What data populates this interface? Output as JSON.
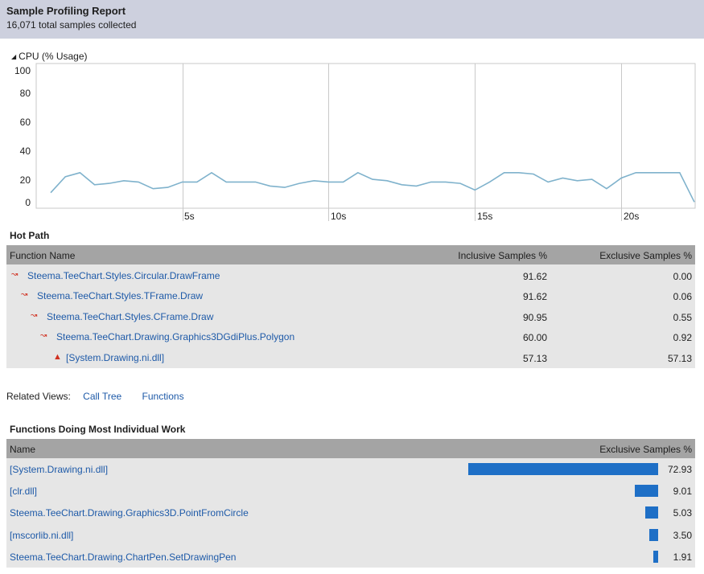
{
  "report": {
    "title": "Sample Profiling Report",
    "subtitle": "16,071 total samples collected"
  },
  "cpu": {
    "title": "CPU (% Usage)",
    "collapse_icon": "triangle-down-icon"
  },
  "chart_data": {
    "type": "line",
    "title": "CPU (% Usage)",
    "xlabel": "",
    "ylabel": "",
    "ylim": [
      0,
      100
    ],
    "xlim": [
      0,
      22
    ],
    "yticks": [
      "100",
      "80",
      "60",
      "40",
      "20",
      "0"
    ],
    "xticks": [
      "5s",
      "10s",
      "15s",
      "20s"
    ],
    "grid": true,
    "line_color": "#7fb2cc",
    "series": [
      {
        "x": [
          0,
          0.5,
          1,
          1.5,
          2,
          2.5,
          3,
          3.5,
          4,
          4.5,
          5,
          5.5,
          6,
          6.5,
          7,
          7.5,
          8,
          8.5,
          9,
          9.5,
          10,
          10.5,
          11,
          11.5,
          12,
          12.5,
          13,
          13.5,
          14,
          14.5,
          15,
          15.5,
          16,
          16.5,
          17,
          17.5,
          18,
          18.5,
          19,
          19.5,
          20,
          20.5,
          21,
          21.5,
          22
        ],
        "values": [
          8,
          20,
          23,
          14,
          15,
          17,
          16,
          11,
          12,
          16,
          16,
          23,
          16,
          16,
          16,
          13,
          12,
          15,
          17,
          16,
          16,
          23,
          18,
          17,
          14,
          13,
          16,
          16,
          15,
          10,
          16,
          23,
          23,
          22,
          16,
          19,
          17,
          18,
          11,
          19,
          23,
          23,
          23,
          23,
          1
        ]
      }
    ]
  },
  "hot_path": {
    "title": "Hot Path",
    "columns": [
      "Function Name",
      "Inclusive Samples %",
      "Exclusive Samples %"
    ],
    "rows": [
      {
        "name": "Steema.TeeChart.Styles.Circular.DrawFrame",
        "inclusive": "91.62",
        "exclusive": "0.00",
        "icon": "hot-path-arrow-icon"
      },
      {
        "name": "Steema.TeeChart.Styles.TFrame.Draw",
        "inclusive": "91.62",
        "exclusive": "0.06",
        "icon": "hot-path-arrow-icon"
      },
      {
        "name": "Steema.TeeChart.Styles.CFrame.Draw",
        "inclusive": "90.95",
        "exclusive": "0.55",
        "icon": "hot-path-arrow-icon"
      },
      {
        "name": "Steema.TeeChart.Drawing.Graphics3DGdiPlus.Polygon",
        "inclusive": "60.00",
        "exclusive": "0.92",
        "icon": "hot-path-arrow-icon"
      },
      {
        "name": "[System.Drawing.ni.dll]",
        "inclusive": "57.13",
        "exclusive": "57.13",
        "icon": "flame-icon"
      }
    ]
  },
  "related_views": {
    "label": "Related Views:",
    "links": [
      "Call Tree",
      "Functions"
    ]
  },
  "most_work": {
    "title": "Functions Doing Most Individual Work",
    "columns": [
      "Name",
      "Exclusive Samples %"
    ],
    "bar_color": "#1e6fc6",
    "rows": [
      {
        "name": "[System.Drawing.ni.dll]",
        "value": "72.93",
        "pct": 72.93
      },
      {
        "name": "[clr.dll]",
        "value": "9.01",
        "pct": 9.01
      },
      {
        "name": "Steema.TeeChart.Drawing.Graphics3D.PointFromCircle",
        "value": "5.03",
        "pct": 5.03
      },
      {
        "name": "[mscorlib.ni.dll]",
        "value": "3.50",
        "pct": 3.5
      },
      {
        "name": "Steema.TeeChart.Drawing.ChartPen.SetDrawingPen",
        "value": "1.91",
        "pct": 1.91
      }
    ]
  }
}
